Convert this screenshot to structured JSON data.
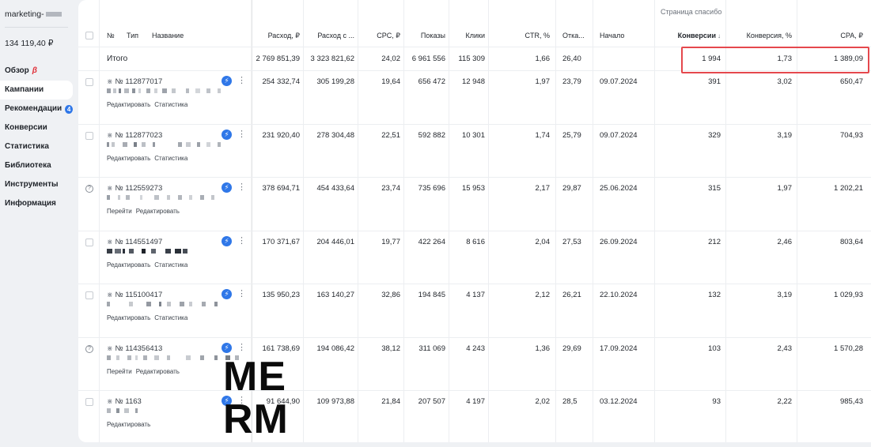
{
  "account": {
    "name": "marketing-",
    "balance": "134 119,40 ₽"
  },
  "nav": [
    {
      "label": "Обзор",
      "beta": "β"
    },
    {
      "label": "Кампании",
      "active": true
    },
    {
      "label": "Рекомендации",
      "badge": "4"
    },
    {
      "label": "Конверсии"
    },
    {
      "label": "Статистика"
    },
    {
      "label": "Библиотека"
    },
    {
      "label": "Инструменты"
    },
    {
      "label": "Информация"
    }
  ],
  "table": {
    "group_label": "Страница спасибо",
    "headers": {
      "num": "№",
      "type": "Тип",
      "name": "Название",
      "spend": "Расход, ₽",
      "spend_vat": "Расход с ...",
      "cpc": "CPC, ₽",
      "impr": "Показы",
      "clicks": "Клики",
      "ctr": "CTR, %",
      "bounce": "Отка...",
      "start": "Начало",
      "conv": "Конверсии",
      "conv_arrow": "↓",
      "convr": "Конверсия, %",
      "cpa": "CPA, ₽"
    },
    "total": {
      "label": "Итого",
      "spend": "2 769 851,39",
      "spend_vat": "3 323 821,62",
      "cpc": "24,02",
      "impr": "6 961 556",
      "clicks": "115 309",
      "ctr": "1,66",
      "bounce": "26,40",
      "conv": "1 994",
      "convr": "1,73",
      "cpa": "1 389,09"
    },
    "rows": [
      {
        "id": "№ 112877017",
        "status": "checkbox",
        "links": [
          "Редактировать",
          "Статистика"
        ],
        "spend": "254 332,74",
        "spend_vat": "305 199,28",
        "cpc": "19,64",
        "impr": "656 472",
        "clicks": "12 948",
        "ctr": "1,97",
        "bounce": "23,79",
        "start": "09.07.2024",
        "conv": "391",
        "convr": "3,02",
        "cpa": "650,47"
      },
      {
        "id": "№ 112877023",
        "status": "checkbox",
        "links": [
          "Редактировать",
          "Статистика"
        ],
        "spend": "231 920,40",
        "spend_vat": "278 304,48",
        "cpc": "22,51",
        "impr": "592 882",
        "clicks": "10 301",
        "ctr": "1,74",
        "bounce": "25,79",
        "start": "09.07.2024",
        "conv": "329",
        "convr": "3,19",
        "cpa": "704,93"
      },
      {
        "id": "№ 112559273",
        "status": "question",
        "links": [
          "Перейти",
          "Редактировать"
        ],
        "spend": "378 694,71",
        "spend_vat": "454 433,64",
        "cpc": "23,74",
        "impr": "735 696",
        "clicks": "15 953",
        "ctr": "2,17",
        "bounce": "29,87",
        "start": "25.06.2024",
        "conv": "315",
        "convr": "1,97",
        "cpa": "1 202,21"
      },
      {
        "id": "№ 114551497",
        "status": "checkbox",
        "links": [
          "Редактировать",
          "Статистика"
        ],
        "spend": "170 371,67",
        "spend_vat": "204 446,01",
        "cpc": "19,77",
        "impr": "422 264",
        "clicks": "8 616",
        "ctr": "2,04",
        "bounce": "27,53",
        "start": "26.09.2024",
        "conv": "212",
        "convr": "2,46",
        "cpa": "803,64"
      },
      {
        "id": "№ 115100417",
        "status": "checkbox",
        "links": [
          "Редактировать",
          "Статистика"
        ],
        "spend": "135 950,23",
        "spend_vat": "163 140,27",
        "cpc": "32,86",
        "impr": "194 845",
        "clicks": "4 137",
        "ctr": "2,12",
        "bounce": "26,21",
        "start": "22.10.2024",
        "conv": "132",
        "convr": "3,19",
        "cpa": "1 029,93"
      },
      {
        "id": "№ 114356413",
        "status": "question",
        "links": [
          "Перейти",
          "Редактировать"
        ],
        "spend": "161 738,69",
        "spend_vat": "194 086,42",
        "cpc": "38,12",
        "impr": "311 069",
        "clicks": "4 243",
        "ctr": "1,36",
        "bounce": "29,69",
        "start": "17.09.2024",
        "conv": "103",
        "convr": "2,43",
        "cpa": "1 570,28"
      },
      {
        "id": "№ 1163",
        "status": "checkbox",
        "links": [
          "Редактировать"
        ],
        "spend": "91 644,90",
        "spend_vat": "109 973,88",
        "cpc": "21,84",
        "impr": "207 507",
        "clicks": "4 197",
        "ctr": "2,02",
        "bounce": "28,5",
        "start": "03.12.2024",
        "conv": "93",
        "convr": "2,22",
        "cpa": "985,43"
      }
    ]
  },
  "watermark": {
    "line1": "ME",
    "line2": "RM"
  },
  "colors": {
    "accent": "#2f77e8",
    "highlight": "#e5484d",
    "beta": "#e0323b"
  }
}
